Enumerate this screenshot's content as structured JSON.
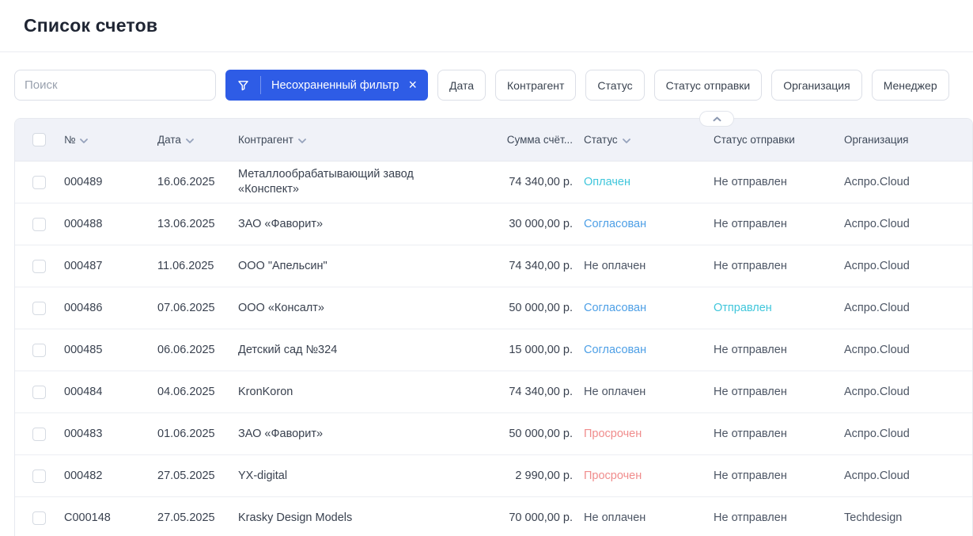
{
  "page": {
    "title": "Список счетов"
  },
  "toolbar": {
    "search_placeholder": "Поиск",
    "active_filter": {
      "label": "Несохраненный фильтр",
      "close_symbol": "×"
    },
    "filter_buttons": [
      "Дата",
      "Контрагент",
      "Статус",
      "Статус отправки",
      "Организация",
      "Менеджер"
    ]
  },
  "table": {
    "columns": [
      {
        "label": "№",
        "sortable": true
      },
      {
        "label": "Дата",
        "sortable": true
      },
      {
        "label": "Контрагент",
        "sortable": true
      },
      {
        "label": "Сумма счёт...",
        "sortable": false
      },
      {
        "label": "Статус",
        "sortable": true
      },
      {
        "label": "Статус отправки",
        "sortable": false
      },
      {
        "label": "Организация",
        "sortable": false
      }
    ],
    "rows": [
      {
        "number": "000489",
        "date": "16.06.2025",
        "contractor": "Металлообрабатывающий завод «Конспект»",
        "amount": "74 340,00 р.",
        "status": {
          "label": "Оплачен",
          "color": "teal"
        },
        "sending": {
          "label": "Не отправлен",
          "color": "plain"
        },
        "organization": "Аспро.Cloud"
      },
      {
        "number": "000488",
        "date": "13.06.2025",
        "contractor": "ЗАО «Фаворит»",
        "amount": "30 000,00 р.",
        "status": {
          "label": "Согласован",
          "color": "blue"
        },
        "sending": {
          "label": "Не отправлен",
          "color": "plain"
        },
        "organization": "Аспро.Cloud"
      },
      {
        "number": "000487",
        "date": "11.06.2025",
        "contractor": "ООО \"Апельсин\"",
        "amount": "74 340,00 р.",
        "status": {
          "label": "Не оплачен",
          "color": "plain"
        },
        "sending": {
          "label": "Не отправлен",
          "color": "plain"
        },
        "organization": "Аспро.Cloud"
      },
      {
        "number": "000486",
        "date": "07.06.2025",
        "contractor": "ООО «Консалт»",
        "amount": "50 000,00 р.",
        "status": {
          "label": "Согласован",
          "color": "blue"
        },
        "sending": {
          "label": "Отправлен",
          "color": "teal"
        },
        "organization": "Аспро.Cloud"
      },
      {
        "number": "000485",
        "date": "06.06.2025",
        "contractor": "Детский сад №324",
        "amount": "15 000,00 р.",
        "status": {
          "label": "Согласован",
          "color": "blue"
        },
        "sending": {
          "label": "Не отправлен",
          "color": "plain"
        },
        "organization": "Аспро.Cloud"
      },
      {
        "number": "000484",
        "date": "04.06.2025",
        "contractor": "KronKoron",
        "amount": "74 340,00 р.",
        "status": {
          "label": "Не оплачен",
          "color": "plain"
        },
        "sending": {
          "label": "Не отправлен",
          "color": "plain"
        },
        "organization": "Аспро.Cloud"
      },
      {
        "number": "000483",
        "date": "01.06.2025",
        "contractor": "ЗАО «Фаворит»",
        "amount": "50 000,00 р.",
        "status": {
          "label": "Просрочен",
          "color": "red"
        },
        "sending": {
          "label": "Не отправлен",
          "color": "plain"
        },
        "organization": "Аспро.Cloud"
      },
      {
        "number": "000482",
        "date": "27.05.2025",
        "contractor": "YX-digital",
        "amount": "2 990,00 р.",
        "status": {
          "label": "Просрочен",
          "color": "red"
        },
        "sending": {
          "label": "Не отправлен",
          "color": "plain"
        },
        "organization": "Аспро.Cloud"
      },
      {
        "number": "C000148",
        "date": "27.05.2025",
        "contractor": "Krasky Design Models",
        "amount": "70 000,00 р.",
        "status": {
          "label": "Не оплачен",
          "color": "plain"
        },
        "sending": {
          "label": "Не отправлен",
          "color": "plain"
        },
        "organization": "Techdesign"
      }
    ]
  },
  "colors": {
    "accent_blue": "#2E5CE6",
    "status_teal": "#3FC6DB",
    "status_blue": "#4D9FE6",
    "status_red": "#F08C8C",
    "header_bg": "#F0F2F8"
  }
}
